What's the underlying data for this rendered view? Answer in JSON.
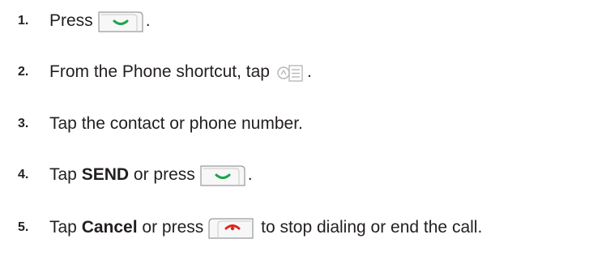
{
  "steps": [
    {
      "number": "1.",
      "text_before": "Press",
      "text_after": "."
    },
    {
      "number": "2.",
      "text_before": "From the Phone shortcut, tap",
      "text_after": "."
    },
    {
      "number": "3.",
      "text_before": "Tap the contact or phone number."
    },
    {
      "number": "4.",
      "text_before": "Tap ",
      "bold": "SEND",
      "text_mid": " or press",
      "text_after": "."
    },
    {
      "number": "5.",
      "text_before": "Tap ",
      "bold": "Cancel",
      "text_mid": " or press",
      "text_after": " to stop dialing or end the call."
    }
  ],
  "icons": {
    "send_key": "green-send-key-icon",
    "contacts": "contacts-list-icon",
    "end_key": "red-end-key-icon"
  },
  "colors": {
    "send_green": "#1aa54b",
    "end_red": "#e2231a",
    "key_outline": "#9a9a9a",
    "text": "#231f20"
  }
}
